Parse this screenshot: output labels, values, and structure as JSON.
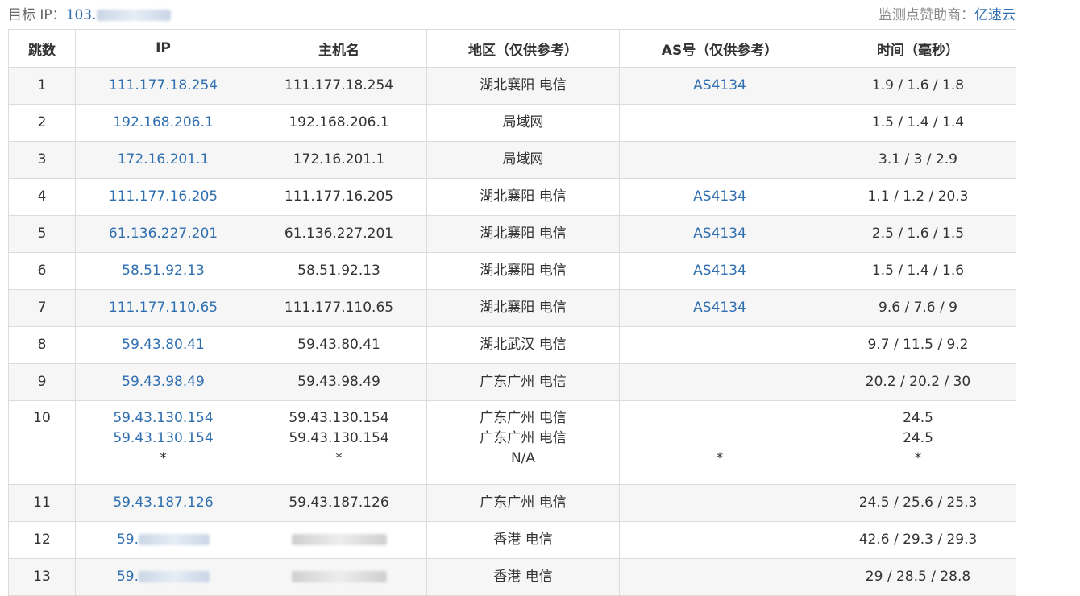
{
  "header": {
    "target_label": "目标 IP：",
    "target_ip_visible": "103.",
    "sponsor_label": "监测点赞助商：",
    "sponsor_name": "亿速云"
  },
  "columns": [
    "跳数",
    "IP",
    "主机名",
    "地区（仅供参考）",
    "AS号（仅供参考）",
    "时间（毫秒）"
  ],
  "hops": [
    {
      "hop": "1",
      "ip": "111.177.18.254",
      "host": "111.177.18.254",
      "region": "湖北襄阳 电信",
      "as": "AS4134",
      "time": "1.9 / 1.6 / 1.8"
    },
    {
      "hop": "2",
      "ip": "192.168.206.1",
      "host": "192.168.206.1",
      "region": "局域网",
      "as": "",
      "time": "1.5 / 1.4 / 1.4"
    },
    {
      "hop": "3",
      "ip": "172.16.201.1",
      "host": "172.16.201.1",
      "region": "局域网",
      "as": "",
      "time": "3.1 / 3 / 2.9"
    },
    {
      "hop": "4",
      "ip": "111.177.16.205",
      "host": "111.177.16.205",
      "region": "湖北襄阳 电信",
      "as": "AS4134",
      "time": "1.1 / 1.2 / 20.3"
    },
    {
      "hop": "5",
      "ip": "61.136.227.201",
      "host": "61.136.227.201",
      "region": "湖北襄阳 电信",
      "as": "AS4134",
      "time": "2.5 / 1.6 / 1.5"
    },
    {
      "hop": "6",
      "ip": "58.51.92.13",
      "host": "58.51.92.13",
      "region": "湖北襄阳 电信",
      "as": "AS4134",
      "time": "1.5 / 1.4 / 1.6"
    },
    {
      "hop": "7",
      "ip": "111.177.110.65",
      "host": "111.177.110.65",
      "region": "湖北襄阳 电信",
      "as": "AS4134",
      "time": "9.6 / 7.6 / 9"
    },
    {
      "hop": "8",
      "ip": "59.43.80.41",
      "host": "59.43.80.41",
      "region": "湖北武汉 电信",
      "as": "",
      "time": "9.7 / 11.5 / 9.2"
    },
    {
      "hop": "9",
      "ip": "59.43.98.49",
      "host": "59.43.98.49",
      "region": "广东广州 电信",
      "as": "",
      "time": "20.2 / 20.2 / 30"
    },
    {
      "hop": "10",
      "ip": [
        "59.43.130.154",
        "59.43.130.154",
        "*"
      ],
      "host": [
        "59.43.130.154",
        "59.43.130.154",
        "*"
      ],
      "region": [
        "广东广州 电信",
        "广东广州 电信",
        "N/A"
      ],
      "as": [
        "",
        "",
        "*"
      ],
      "time": [
        "24.5",
        "24.5",
        "*"
      ]
    },
    {
      "hop": "11",
      "ip": "59.43.187.126",
      "host": "59.43.187.126",
      "region": "广东广州 电信",
      "as": "",
      "time": "24.5 / 25.6 / 25.3"
    },
    {
      "hop": "12",
      "ip": "59.",
      "host": "",
      "region": "香港 电信",
      "as": "",
      "time": "42.6 / 29.3 / 29.3"
    },
    {
      "hop": "13",
      "ip": "59.",
      "host": "",
      "region": "香港 电信",
      "as": "",
      "time": "29 / 28.5 / 28.8"
    }
  ],
  "colors": {
    "link": "#2f6fb0",
    "row_alt": "#f6f6f6",
    "border": "#dcdcdc"
  }
}
